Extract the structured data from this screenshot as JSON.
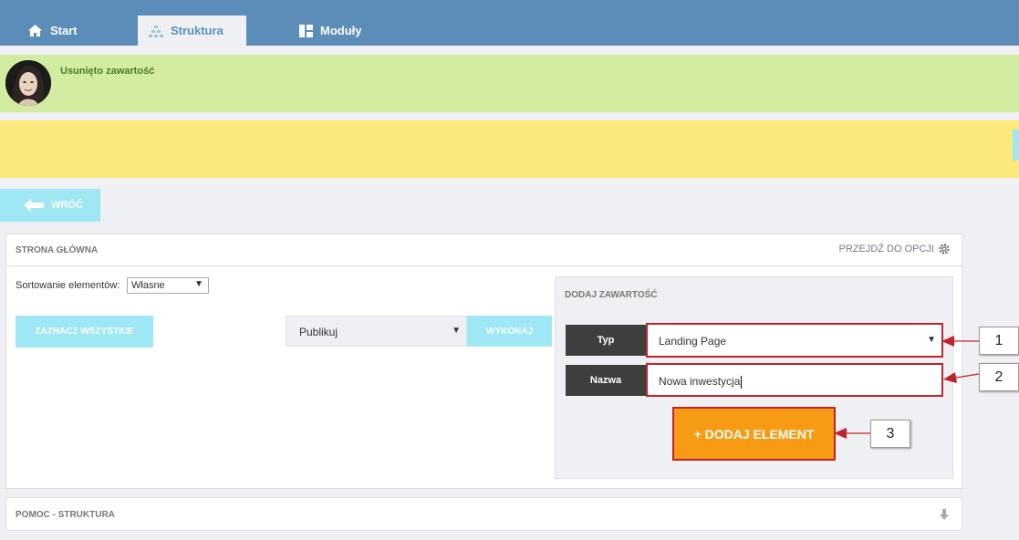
{
  "nav": {
    "tabs": [
      {
        "label": "Start",
        "icon": "home-icon"
      },
      {
        "label": "Struktura",
        "icon": "sitemap-icon",
        "active": true
      },
      {
        "label": "Moduły",
        "icon": "modules-icon"
      }
    ]
  },
  "message": {
    "text": "Usunięto zawartość"
  },
  "back_button": {
    "label": "WRÓĆ"
  },
  "main_panel": {
    "title": "STRONA GŁÓWNA",
    "options_link": "PRZEJDŹ DO OPCJI",
    "sort_label": "Sortowanie elementów:",
    "sort_value": "Własne",
    "select_all_label": "ZAZNACZ WSZYSTKIE",
    "bulk_action_value": "Publikuj",
    "execute_label": "WYKONAJ"
  },
  "add_content": {
    "title": "DODAJ ZAWARTOŚĆ",
    "type_label": "Typ",
    "type_value": "Landing Page",
    "name_label": "Nazwa",
    "name_value": "Nowa inwestycja",
    "add_button_label": "+ DODAJ ELEMENT"
  },
  "callouts": [
    "1",
    "2",
    "3"
  ],
  "help_panel": {
    "title": "POMOC - STRUKTURA"
  },
  "colors": {
    "nav": "#5b8db8",
    "success_bar": "#d2eca1",
    "warning_bar": "#fbe97c",
    "accent_cyan": "#9ee7f5",
    "add_button": "#f79a14",
    "highlight_border": "#c0232a"
  }
}
